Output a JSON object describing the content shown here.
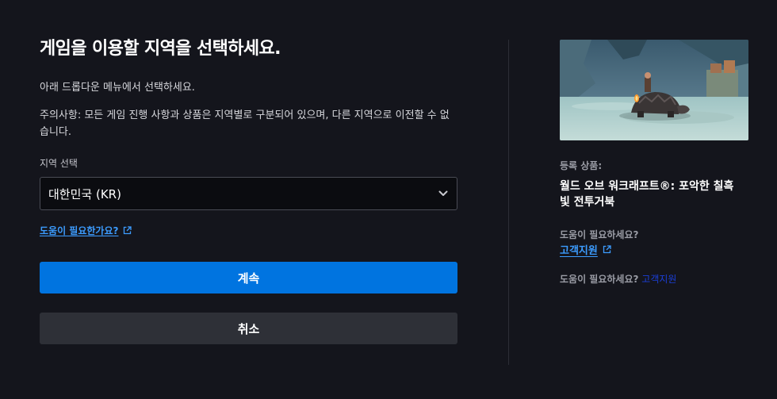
{
  "region": {
    "title": "게임을 이용할 지역을 선택하세요.",
    "subtitle": "아래 드롭다운 메뉴에서 선택하세요.",
    "notice": "주의사항: 모든 게임 진행 사항과 상품은 지역별로 구분되어 있으며, 다른 지역으로 이전할 수 없습니다.",
    "select_label": "지역 선택",
    "selected_value": "대한민국 (KR)",
    "help_link": "도움이 필요한가요?",
    "continue_label": "계속",
    "cancel_label": "취소"
  },
  "sidebar": {
    "registered_label": "등록 상품:",
    "product_name": "월드 오브 워크래프트®: 포악한 칠흑빛 전투거북",
    "help_question": "도움이 필요하세요?",
    "support_link": "고객지원",
    "help_line_question": "도움이 필요하세요?",
    "help_line_link": "고객지원"
  },
  "colors": {
    "background": "#14151c",
    "primary_button": "#0074e0",
    "secondary_button": "#2e3037",
    "link": "#3c9cff"
  },
  "icons": {
    "select_chevron": "chevron-down-icon",
    "external_link": "external-link-icon"
  }
}
